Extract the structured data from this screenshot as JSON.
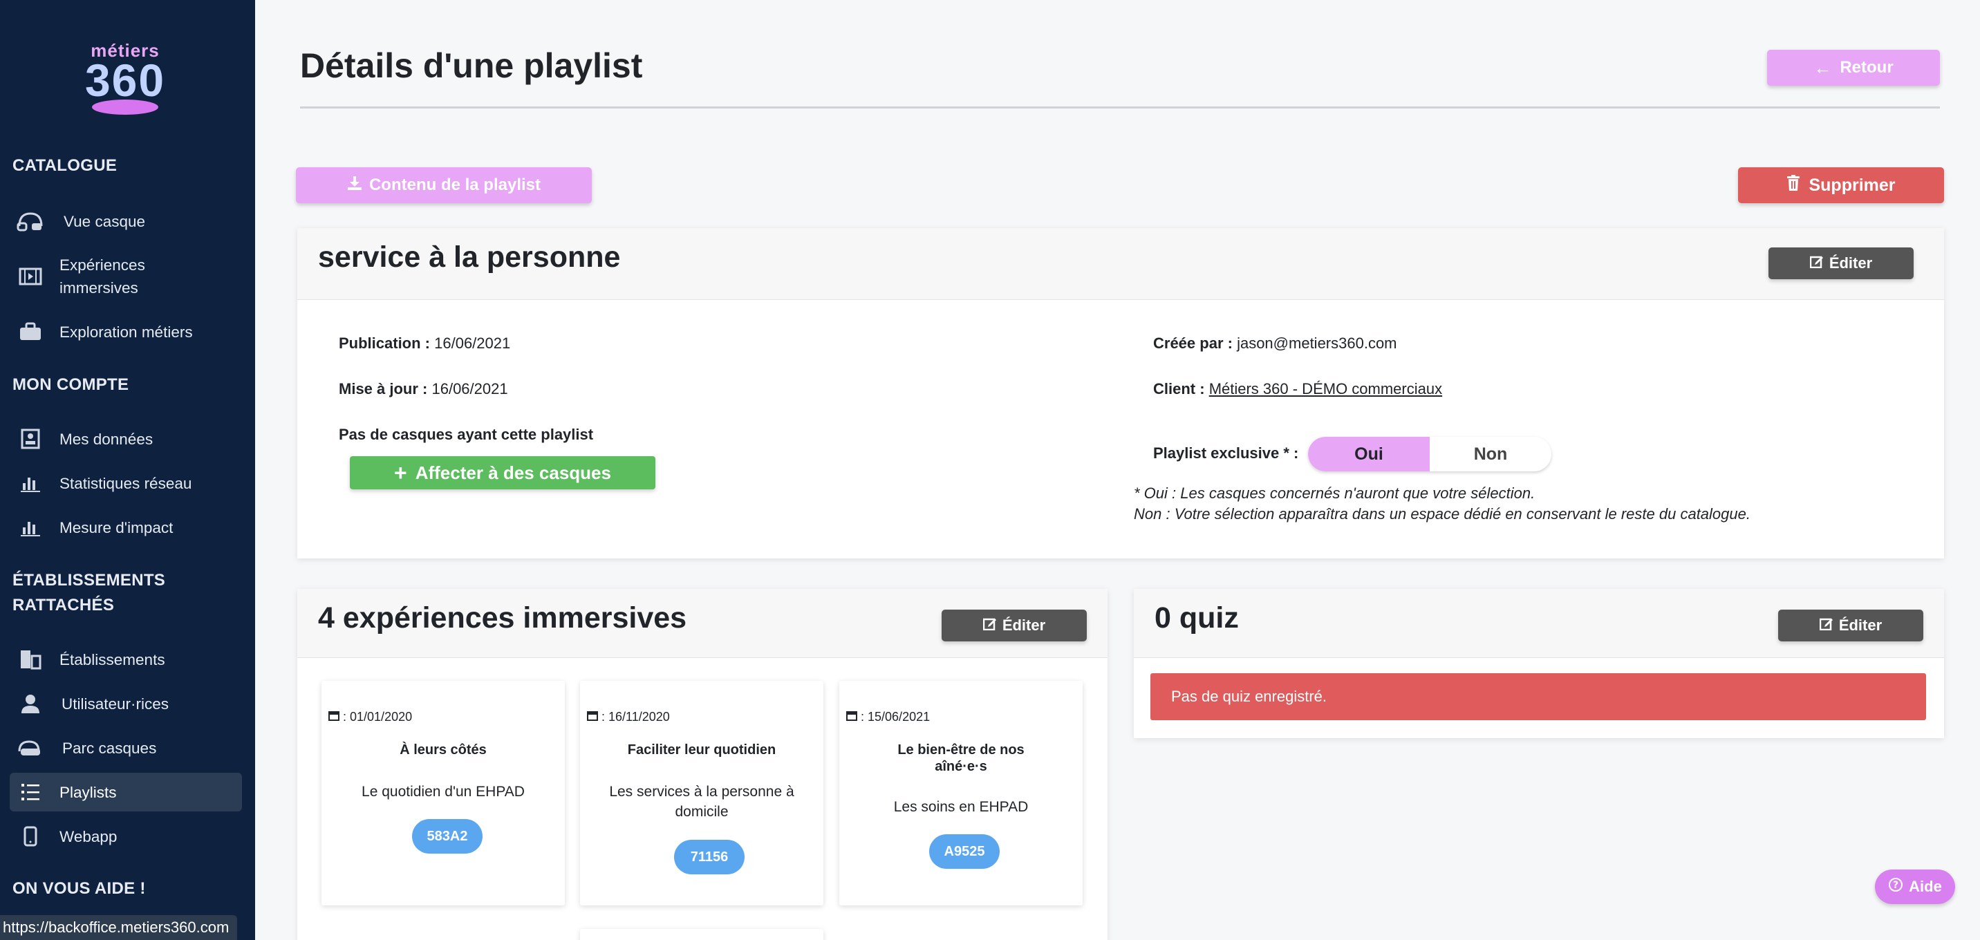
{
  "sidebar": {
    "logo": {
      "word": "métiers",
      "number": "360"
    },
    "sections": {
      "catalogue": "CATALOGUE",
      "mon_compte": "MON COMPTE",
      "etablissements_line1": "ÉTABLISSEMENTS",
      "etablissements_line2": "RATTACHÉS",
      "aide": "ON VOUS AIDE !"
    },
    "items": {
      "vue_casque": "Vue casque",
      "experiences_line1": "Expériences",
      "experiences_line2": "immersives",
      "exploration": "Exploration métiers",
      "mes_donnees": "Mes données",
      "statistiques": "Statistiques réseau",
      "mesure": "Mesure d'impact",
      "etablissements": "Établissements",
      "utilisateurs": "Utilisateur·rices",
      "parc": "Parc casques",
      "playlists": "Playlists",
      "webapp": "Webapp"
    }
  },
  "status_url": "https://backoffice.metiers360.com",
  "header": {
    "title": "Détails d'une playlist",
    "retour": "Retour"
  },
  "actions": {
    "contenu": "Contenu de la playlist",
    "supprimer": "Supprimer"
  },
  "playlist": {
    "name": "service à la personne",
    "edit": "Éditer",
    "publication_label": "Publication :",
    "publication_value": "16/06/2021",
    "maj_label": "Mise à jour :",
    "maj_value": "16/06/2021",
    "casques_text": "Pas de casques ayant cette playlist",
    "affecter": "Affecter à des casques",
    "creee_label": "Créée par :",
    "creee_value": "jason@metiers360.com",
    "client_label": "Client :",
    "client_value": "Métiers 360 - DÉMO commerciaux",
    "exclusive_label": "Playlist exclusive * :",
    "oui": "Oui",
    "non": "Non",
    "note_line1": "* Oui : Les casques concernés n'auront que votre sélection.",
    "note_line2": "Non : Votre sélection apparaîtra dans un espace dédié en conservant le reste du catalogue."
  },
  "experiences": {
    "title": "4 expériences immersives",
    "edit": "Éditer",
    "cards": [
      {
        "date": ": 01/01/2020",
        "title": "À leurs côtés",
        "subtitle": "Le quotidien d'un EHPAD",
        "code": "583A2"
      },
      {
        "date": ": 16/11/2020",
        "title": "Faciliter leur quotidien",
        "subtitle": "Les services à la personne à domicile",
        "code": "71156"
      },
      {
        "date": ": 15/06/2021",
        "title": "Le bien-être de nos aîné·e·s",
        "subtitle": "Les soins en EHPAD",
        "code": "A9525"
      }
    ]
  },
  "quiz": {
    "title": "0 quiz",
    "edit": "Éditer",
    "empty": "Pas de quiz enregistré."
  },
  "help": "Aide",
  "colors": {
    "sidebar": "#0e2240",
    "pink": "#e8a6f7",
    "red": "#de5c5c",
    "green": "#5cbd5f",
    "blue": "#5aa7f0"
  }
}
